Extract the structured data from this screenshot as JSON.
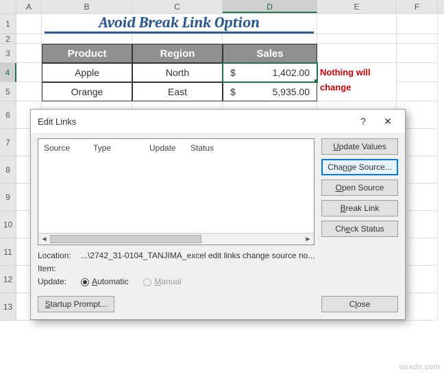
{
  "columns": [
    "A",
    "B",
    "C",
    "D",
    "E",
    "F"
  ],
  "rows": [
    "1",
    "2",
    "3",
    "4",
    "5",
    "6",
    "7",
    "8",
    "9",
    "10",
    "11",
    "12",
    "13"
  ],
  "activeCol": "D",
  "activeRow": "4",
  "title": "Avoid Break Link Option",
  "table": {
    "headers": {
      "product": "Product",
      "region": "Region",
      "sales": "Sales"
    },
    "rows": [
      {
        "product": "Apple",
        "region": "North",
        "currency": "$",
        "sales": "1,402.00"
      },
      {
        "product": "Orange",
        "region": "East",
        "currency": "$",
        "sales": "5,935.00"
      }
    ]
  },
  "note": {
    "line1": "Nothing will",
    "line2": "change"
  },
  "dialog": {
    "title": "Edit Links",
    "help": "?",
    "close": "✕",
    "list_headers": {
      "source": "Source",
      "type": "Type",
      "update": "Update",
      "status": "Status"
    },
    "buttons": {
      "update_values": "pdate Values",
      "update_values_u": "U",
      "change_source": "Chage Source...",
      "change_source_u": "n",
      "open_source": "pen Source",
      "open_source_u": "O",
      "break_link": "reak Link",
      "break_link_u": "B",
      "check_status": "Chck Status",
      "check_status_u": "e",
      "startup": "tartup Prompt...",
      "startup_u": "S",
      "close": "Cose",
      "close_u": "l"
    },
    "meta": {
      "location_label": "Location:",
      "location_value": "...\\2742_31-0104_TANJIMA_excel edit links change source no...",
      "item_label": "Item:",
      "update_label": "Update:",
      "auto": "utomatic",
      "auto_u": "A",
      "manual": "anual",
      "manual_u": "M"
    }
  },
  "watermark": "wsxdn.com"
}
